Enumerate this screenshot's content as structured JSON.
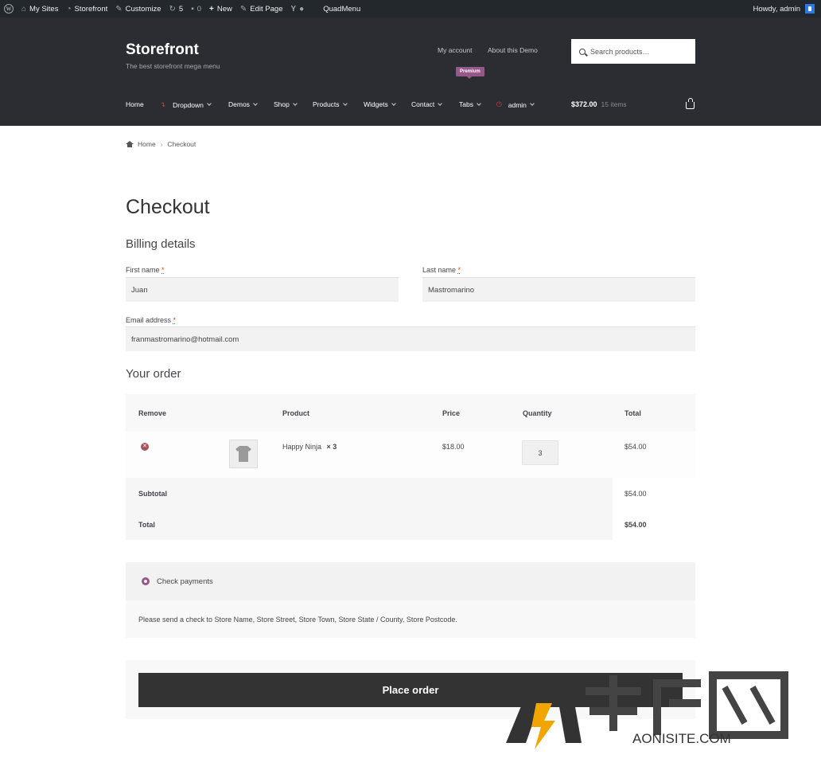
{
  "admin_bar": {
    "my_sites": "My Sites",
    "storefront": "Storefront",
    "customize": "Customize",
    "updates": "5",
    "comments": "0",
    "new": "New",
    "edit_page": "Edit Page",
    "quadmenu": "QuadMenu",
    "howdy": "Howdy, admin"
  },
  "header": {
    "site_title": "Storefront",
    "site_desc": "The best storefront mega menu",
    "my_account": "My account",
    "about": "About this Demo",
    "search_placeholder": "Search products…",
    "badge": "Premium",
    "cart_total": "$372.00",
    "cart_count": "15 items",
    "nav": [
      "Home",
      "Dropdown",
      "Demos",
      "Shop",
      "Products",
      "Widgets",
      "Contact",
      "Tabs",
      "admin"
    ]
  },
  "breadcrumb": {
    "home": "Home",
    "current": "Checkout"
  },
  "page_title": "Checkout",
  "billing": {
    "heading": "Billing details",
    "first_name_label": "First name",
    "last_name_label": "Last name",
    "email_label": "Email address",
    "required": "*",
    "first_name": "Juan",
    "last_name": "Mastromarino",
    "email": "franmastromarino@hotmail.com"
  },
  "order": {
    "heading": "Your order",
    "columns": {
      "remove": "Remove",
      "product": "Product",
      "price": "Price",
      "quantity": "Quantity",
      "total": "Total"
    },
    "item": {
      "name": "Happy Ninja",
      "qty_label": "× 3",
      "price": "$18.00",
      "qty": "3",
      "total": "$54.00"
    },
    "subtotal_label": "Subtotal",
    "subtotal": "$54.00",
    "total_label": "Total",
    "total": "$54.00"
  },
  "payment": {
    "method": "Check payments",
    "description": "Please send a check to Store Name, Store Street, Store Town, Store State / County, Store Postcode.",
    "place_order": "Place order"
  },
  "watermark": {
    "text": "AONISITE.COM"
  }
}
